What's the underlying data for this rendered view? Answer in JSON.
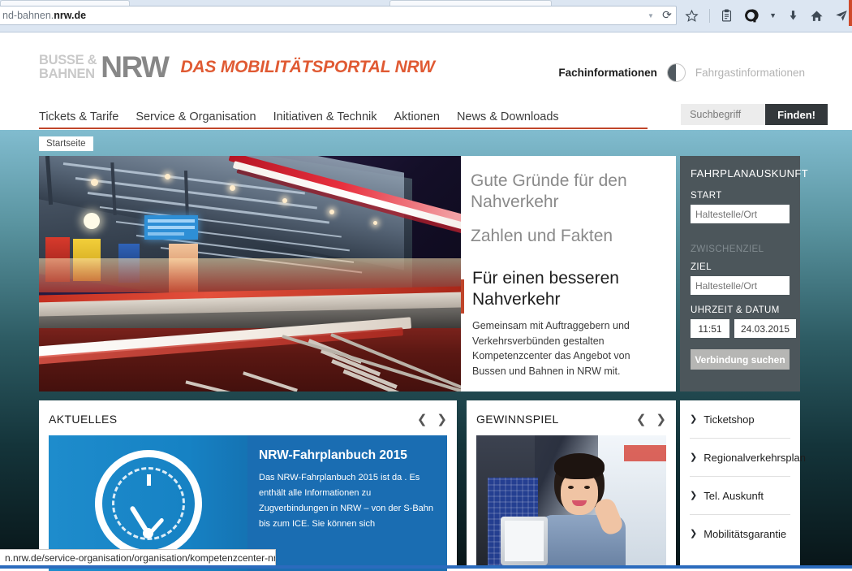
{
  "browser": {
    "url_prefix": "nd-bahnen.",
    "url_bold": "nrw.de",
    "reload_icon": "reload-icon",
    "dropdown_icon": "chevron-down-icon",
    "toolbar_icons": [
      {
        "name": "bookmark-star-icon",
        "glyph": "☆"
      },
      {
        "name": "reader-mode-icon",
        "glyph": "ὌB"
      },
      {
        "name": "qwant-search-icon",
        "glyph": "Q"
      },
      {
        "name": "overflow-chevron-icon",
        "glyph": "▾"
      },
      {
        "name": "downloads-icon",
        "glyph": "↓"
      },
      {
        "name": "home-icon",
        "glyph": "⌂"
      },
      {
        "name": "send-tab-icon",
        "glyph": "➤"
      }
    ],
    "status_url": "n.nrw.de/service-organisation/organisation/kompetenzcenter-nrw/"
  },
  "header": {
    "logo_line1": "BUSSE &",
    "logo_line2": "BAHNEN",
    "logo_nrw": "NRW",
    "slogan": "DAS MOBILITÄTSPORTAL NRW",
    "audience_active": "Fachinformationen",
    "audience_inactive": "Fahrgastinformationen",
    "switch_icon": "half-circle-toggle-icon"
  },
  "nav": {
    "items": [
      {
        "label": "Tickets & Tarife"
      },
      {
        "label": "Service & Organisation"
      },
      {
        "label": "Initiativen & Technik"
      },
      {
        "label": "Aktionen"
      },
      {
        "label": "News & Downloads"
      }
    ]
  },
  "search": {
    "value": "",
    "placeholder": "Suchbegriff",
    "button_label": "Finden!"
  },
  "breadcrumb": {
    "label": "Startseite"
  },
  "hero": {
    "image_name": "night-train-station-photo",
    "headline_1": "Gute Gründe für den Nahverkehr",
    "headline_2": "Zahlen und Fakten",
    "title_2": "Für einen besseren Nahverkehr",
    "body_2": "Gemeinsam mit Auftraggebern und Verkehrsverbünden gestalten Kompetenzcenter das Angebot von Bussen und Bahnen in NRW mit."
  },
  "planner": {
    "title": "FAHRPLANAUSKUNFT",
    "start_label": "START",
    "start_value": "",
    "start_placeholder": "Haltestelle/Ort",
    "via_label": "ZWISCHENZIEL",
    "dest_label": "ZIEL",
    "dest_value": "",
    "dest_placeholder": "Haltestelle/Ort",
    "datetime_label": "UHRZEIT & DATUM",
    "time_value": "11:51",
    "date_value": "24.03.2015",
    "submit_label": "Verbindung suchen"
  },
  "cards": {
    "aktuelles": {
      "title": "AKTUELLES",
      "prev_icon": "chevron-left-icon",
      "next_icon": "chevron-right-icon",
      "teaser_image_name": "speedometer-clock-illustration",
      "teaser_title": "NRW-Fahrplanbuch 2015",
      "teaser_body": "Das NRW-Fahrplanbuch 2015 ist da . Es enthält alle Informationen zu Zugverbindungen in NRW – von der S-Bahn bis zum ICE. Sie können sich"
    },
    "gewinnspiel": {
      "title": "GEWINNSPIEL",
      "prev_icon": "chevron-left-icon",
      "next_icon": "chevron-right-icon",
      "image_name": "woman-with-tablet-in-bus-photo"
    }
  },
  "quicklinks": {
    "items": [
      {
        "label": "Ticketshop"
      },
      {
        "label": "Regionalverkehrsplan"
      },
      {
        "label": "Tel. Auskunft"
      },
      {
        "label": "Mobilitätsgarantie"
      }
    ]
  },
  "colors": {
    "accent_red": "#c0452a",
    "slogan_orange": "#e05a33",
    "planner_bg": "#4c565b",
    "teaser_blue": "#1a6db2",
    "search_button_bg": "#33383b"
  }
}
